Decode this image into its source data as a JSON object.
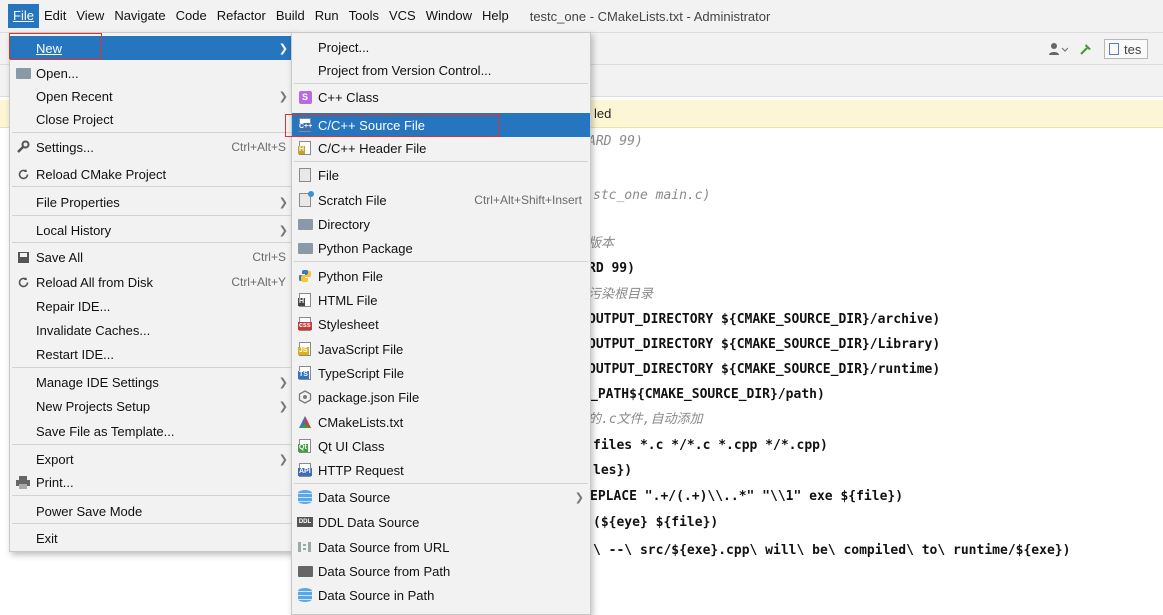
{
  "menubar": {
    "items": [
      "File",
      "Edit",
      "View",
      "Navigate",
      "Code",
      "Refactor",
      "Build",
      "Run",
      "Tools",
      "VCS",
      "Window",
      "Help"
    ],
    "window_title": "testc_one - CMakeLists.txt - Administrator"
  },
  "toolbar": {
    "config_label": "tes"
  },
  "banner": {
    "text": "led"
  },
  "code_lines": [
    "ARD 99)",
    "stc_one main.c)",
    "版本",
    "RD 99)",
    "污染根目录",
    "OUTPUT_DIRECTORY ${CMAKE_SOURCE_DIR}/archive)",
    "OUTPUT_DIRECTORY ${CMAKE_SOURCE_DIR}/Library)",
    "OUTPUT_DIRECTORY ${CMAKE_SOURCE_DIR}/runtime)",
    "_PATH${CMAKE_SOURCE_DIR}/path)",
    "的.c文件,自动添加",
    "files *.c */*.c *.cpp */*.cpp)",
    "les})",
    "EPLACE \".+/(.+)\\\\..*\" \"\\\\1\" exe ${file})",
    "(${eye} ${file})",
    "\\ --\\ src/${exe}.cpp\\ will\\ be\\ compiled\\ to\\ runtime/${exe})"
  ],
  "file_menu": {
    "new": "New",
    "open": "Open...",
    "open_recent": "Open Recent",
    "close_project": "Close Project",
    "settings": "Settings...",
    "settings_shortcut": "Ctrl+Alt+S",
    "reload_cmake": "Reload CMake Project",
    "file_properties": "File Properties",
    "local_history": "Local History",
    "save_all": "Save All",
    "save_all_shortcut": "Ctrl+S",
    "reload_disk": "Reload All from Disk",
    "reload_disk_shortcut": "Ctrl+Alt+Y",
    "repair_ide": "Repair IDE...",
    "invalidate_caches": "Invalidate Caches...",
    "restart_ide": "Restart IDE...",
    "manage_settings": "Manage IDE Settings",
    "new_projects_setup": "New Projects Setup",
    "save_as_template": "Save File as Template...",
    "export": "Export",
    "print": "Print...",
    "power_save": "Power Save Mode",
    "exit": "Exit"
  },
  "new_menu": {
    "project": "Project...",
    "project_vcs": "Project from Version Control...",
    "cpp_class": "C++ Class",
    "c_source": "C/C++ Source File",
    "c_header": "C/C++ Header File",
    "file": "File",
    "scratch": "Scratch File",
    "scratch_shortcut": "Ctrl+Alt+Shift+Insert",
    "directory": "Directory",
    "python_package": "Python Package",
    "python_file": "Python File",
    "html_file": "HTML File",
    "stylesheet": "Stylesheet",
    "js_file": "JavaScript File",
    "ts_file": "TypeScript File",
    "package_json": "package.json File",
    "cmakelists": "CMakeLists.txt",
    "qt_ui": "Qt UI Class",
    "http_request": "HTTP Request",
    "data_source": "Data Source",
    "ddl_source": "DDL Data Source",
    "ds_url": "Data Source from URL",
    "ds_path": "Data Source from Path",
    "ds_in_path": "Data Source in Path"
  },
  "colors": {
    "selection": "#2675bf",
    "highlight_box": "#e0302f",
    "banner": "#fdf6d4"
  }
}
